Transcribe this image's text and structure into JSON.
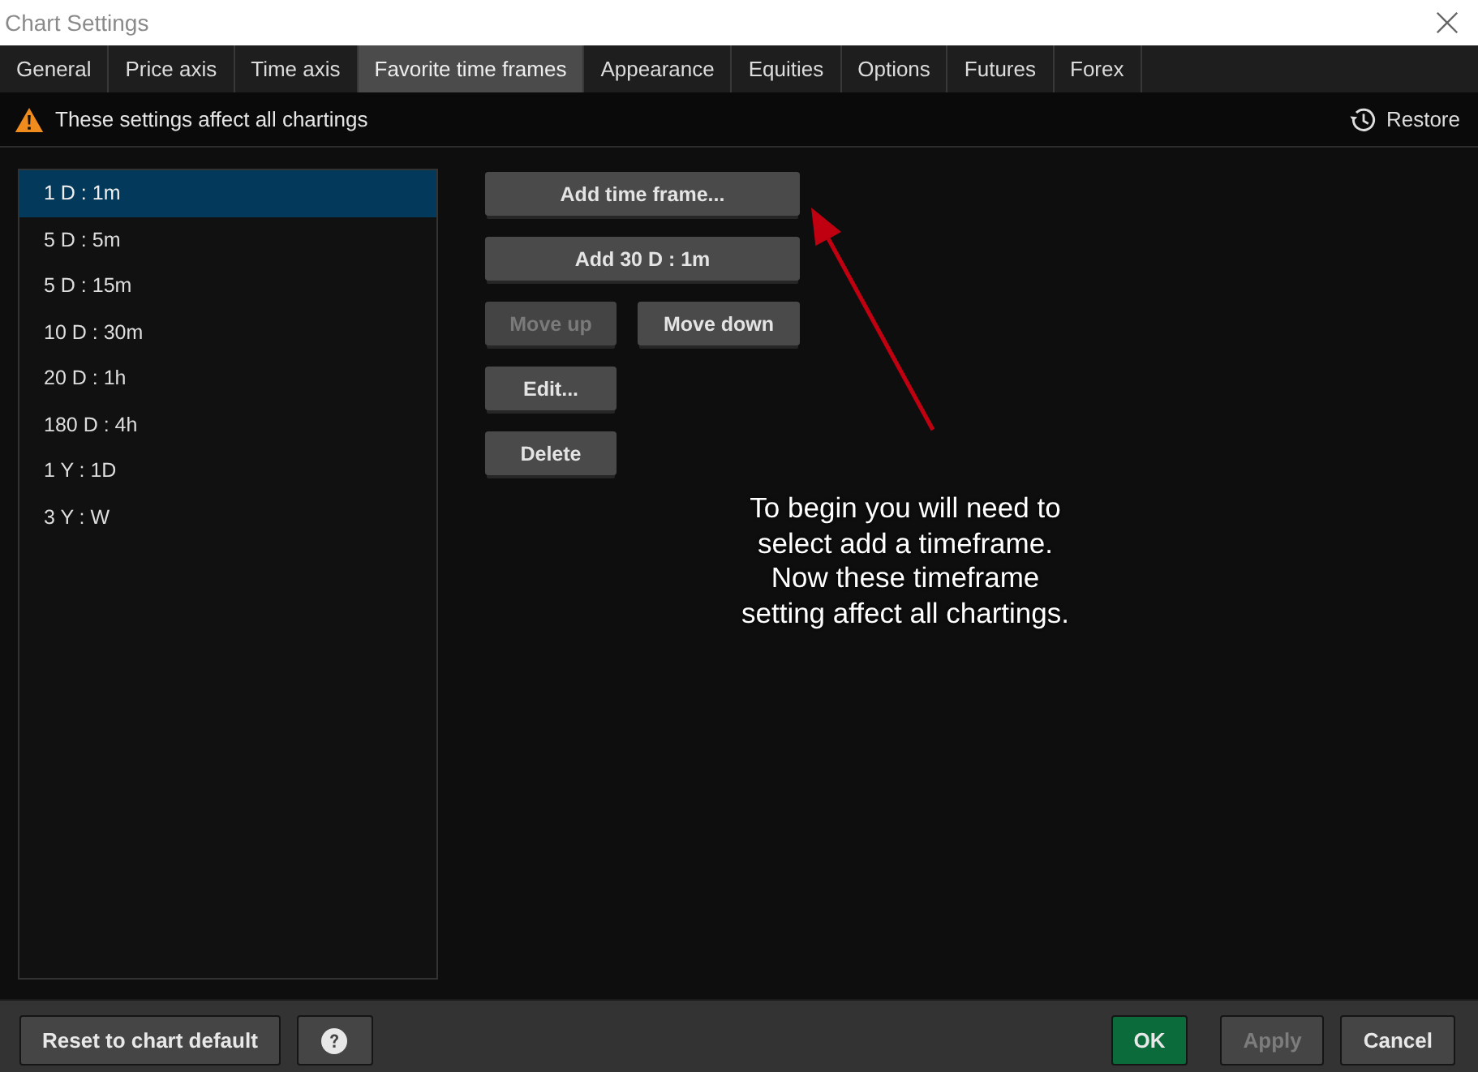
{
  "window": {
    "title": "Chart Settings"
  },
  "tabs": [
    {
      "label": "General",
      "selected": false
    },
    {
      "label": "Price axis",
      "selected": false
    },
    {
      "label": "Time axis",
      "selected": false
    },
    {
      "label": "Favorite time frames",
      "selected": true
    },
    {
      "label": "Appearance",
      "selected": false
    },
    {
      "label": "Equities",
      "selected": false
    },
    {
      "label": "Options",
      "selected": false
    },
    {
      "label": "Futures",
      "selected": false
    },
    {
      "label": "Forex",
      "selected": false
    }
  ],
  "notice": {
    "text": "These settings affect all chartings"
  },
  "restore_button": {
    "label": "Restore"
  },
  "time_frames": [
    {
      "label": "1 D : 1m",
      "selected": true
    },
    {
      "label": "5 D : 5m",
      "selected": false
    },
    {
      "label": "5 D : 15m",
      "selected": false
    },
    {
      "label": "10 D : 30m",
      "selected": false
    },
    {
      "label": "20 D : 1h",
      "selected": false
    },
    {
      "label": "180 D : 4h",
      "selected": false
    },
    {
      "label": "1 Y : 1D",
      "selected": false
    },
    {
      "label": "3 Y : W",
      "selected": false
    }
  ],
  "action_rows": [
    [
      {
        "label": "Add time frame...",
        "kind": "wide",
        "disabled": false
      }
    ],
    [
      {
        "label": "Add 30 D : 1m",
        "kind": "wide",
        "disabled": false
      }
    ],
    [
      {
        "label": "Move up",
        "kind": "small",
        "disabled": true
      },
      {
        "label": "Move down",
        "kind": "small",
        "disabled": false
      }
    ],
    [
      {
        "label": "Edit...",
        "kind": "small",
        "disabled": false
      }
    ],
    [
      {
        "label": "Delete",
        "kind": "small",
        "disabled": false
      }
    ]
  ],
  "annotation": {
    "text": "To begin you will need to\nselect add a timeframe.\nNow these timeframe\nsetting affect all chartings."
  },
  "footer_left": [
    {
      "kind": "default",
      "label": "Reset to chart default",
      "disabled": false
    },
    {
      "kind": "help",
      "disabled": false
    }
  ],
  "footer_right": [
    {
      "kind": "primary",
      "label": "OK",
      "disabled": false
    },
    {
      "kind": "default",
      "label": "Apply",
      "disabled": true
    },
    {
      "kind": "default",
      "label": "Cancel",
      "disabled": false
    }
  ]
}
